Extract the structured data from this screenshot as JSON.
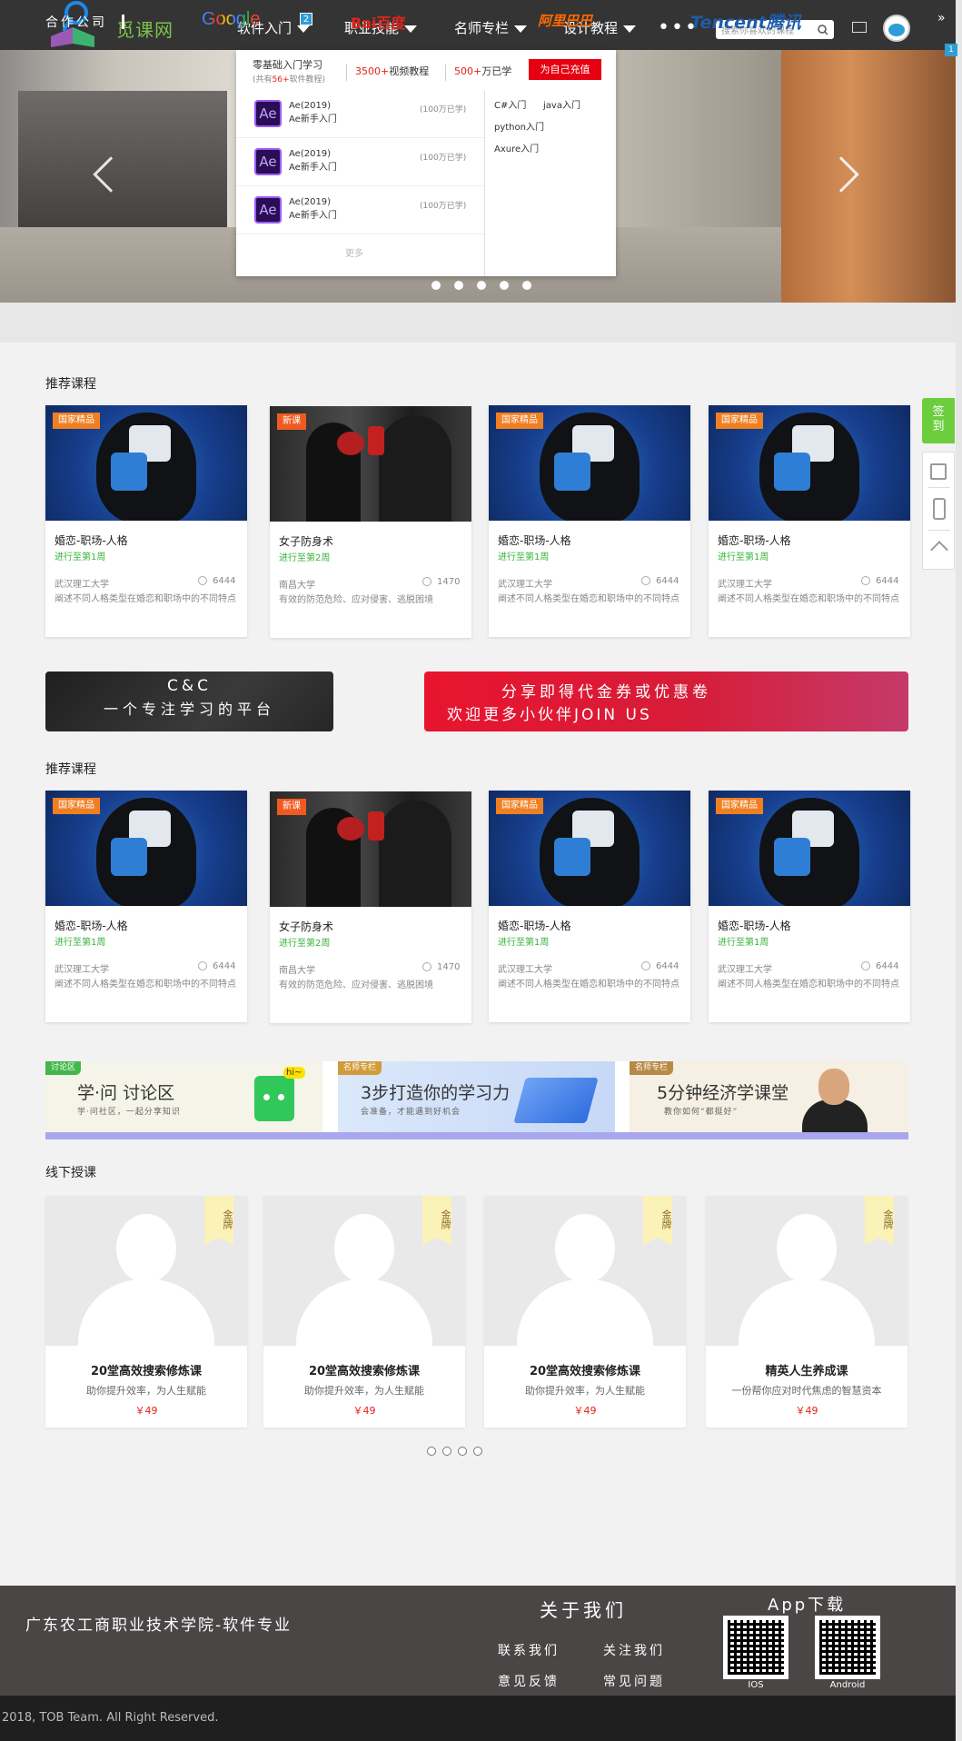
{
  "header": {
    "logo_text": "觅课网",
    "nav": [
      {
        "label": "软件入门",
        "badge": "2"
      },
      {
        "label": "职业技能"
      },
      {
        "label": "名师专栏"
      },
      {
        "label": "设计教程"
      }
    ],
    "more": "•••",
    "search_placeholder": "搜索你喜欢的课程"
  },
  "scroll_badge": "1",
  "dropdown": {
    "title": "零基础入门学习",
    "sub_prefix": "(共有",
    "sub_count": "56+",
    "sub_suffix": "软件教程)",
    "stat1_num": "3500+",
    "stat1_text": "视频教程",
    "stat2_num": "500+",
    "stat2_text": "万已学",
    "charge": "为自己充值",
    "items": [
      {
        "icon": "Ae",
        "name": "Ae(2019)",
        "desc": "Ae新手入门",
        "count": "(100万已学)"
      },
      {
        "icon": "Ae",
        "name": "Ae(2019)",
        "desc": "Ae新手入门",
        "count": "(100万已学)"
      },
      {
        "icon": "Ae",
        "name": "Ae(2019)",
        "desc": "Ae新手入门",
        "count": "(100万已学)"
      }
    ],
    "more": "更多",
    "links": [
      "C#入门",
      "java入门",
      "python入门",
      "Axure入门"
    ]
  },
  "partners": {
    "label": "合作公司",
    "logos": [
      "Google",
      "Bai百度",
      "阿里巴巴",
      "Tencent腾讯"
    ],
    "arrow": "»"
  },
  "sections": {
    "recommend1": "推荐课程",
    "recommend2": "推荐课程",
    "offline": "线下授课"
  },
  "courses": [
    {
      "tag": "国家精品",
      "title": "婚恋-职场-人格",
      "progress": "进行至第1周",
      "school": "武汉理工大学",
      "count": "6444",
      "desc": "阐述不同人格类型在婚恋和职场中的不同特点",
      "image": "puzzle"
    },
    {
      "tag": "新课",
      "title": "女子防身术",
      "progress": "进行至第2周",
      "school": "南昌大学",
      "count": "1470",
      "desc": "有效的防范危险、应对侵害、逃脱困境",
      "image": "fight"
    },
    {
      "tag": "国家精品",
      "title": "婚恋-职场-人格",
      "progress": "进行至第1周",
      "school": "武汉理工大学",
      "count": "6444",
      "desc": "阐述不同人格类型在婚恋和职场中的不同特点",
      "image": "puzzle"
    },
    {
      "tag": "国家精品",
      "title": "婚恋-职场-人格",
      "progress": "进行至第1周",
      "school": "武汉理工大学",
      "count": "6444",
      "desc": "阐述不同人格类型在婚恋和职场中的不同特点",
      "image": "puzzle"
    }
  ],
  "promo": {
    "left_line1": "C&C",
    "left_line2": "一个专注学习的平台",
    "right_line1": "分享即得代金券或优惠卷",
    "right_line2": "欢迎更多小伙伴JOIN US"
  },
  "features": [
    {
      "tag": "讨论区",
      "title": "学·问 讨论区",
      "sub": "学·问社区，一起分享知识",
      "bubble": "hi~"
    },
    {
      "tag": "名师专栏",
      "title": "3步打造你的学习力",
      "sub": "会准备，才能遇到好机会"
    },
    {
      "tag": "名师专栏",
      "title": "5分钟经济学课堂",
      "sub": "教你如何“都挺好”"
    }
  ],
  "offline": [
    {
      "medal": "金牌",
      "title": "20堂高效搜索修炼课",
      "sub": "助你提升效率，为人生赋能",
      "price": "￥49"
    },
    {
      "medal": "金牌",
      "title": "20堂高效搜索修炼课",
      "sub": "助你提升效率，为人生赋能",
      "price": "￥49"
    },
    {
      "medal": "金牌",
      "title": "20堂高效搜索修炼课",
      "sub": "助你提升效率，为人生赋能",
      "price": "￥49"
    },
    {
      "medal": "金牌",
      "title": "精英人生养成课",
      "sub": "一份帮你应对时代焦虑的智慧资本",
      "price": "￥49"
    }
  ],
  "sidebar": {
    "sign": "签到"
  },
  "footer": {
    "school": "广东农工商职业技术学院-软件专业",
    "about": "关于我们",
    "links": [
      "联系我们",
      "关注我们",
      "意见反馈",
      "常见问题"
    ],
    "app": "App下载",
    "ios": "IOS",
    "android": "Android",
    "copyright": "2018, TOB Team. All Right Reserved."
  },
  "colors": {
    "accent_green": "#6ccd3d",
    "accent_red": "#e60012",
    "header_bg": "#343434",
    "footer_bg": "#4a4646"
  }
}
